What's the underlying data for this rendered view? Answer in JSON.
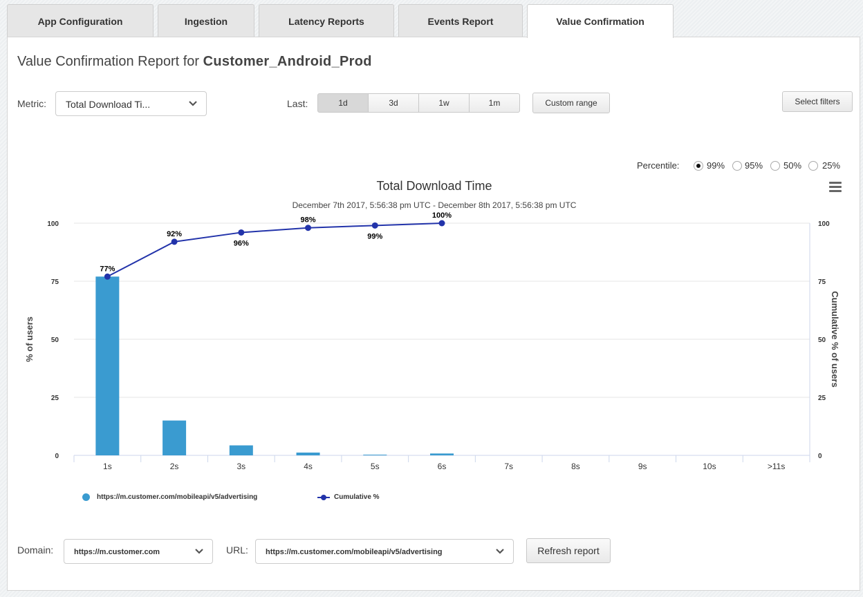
{
  "tabs": [
    {
      "label": "App Configuration",
      "active": false
    },
    {
      "label": "Ingestion",
      "active": false
    },
    {
      "label": "Latency Reports",
      "active": false
    },
    {
      "label": "Events Report",
      "active": false
    },
    {
      "label": "Value Confirmation",
      "active": true
    }
  ],
  "report": {
    "title_prefix": "Value Confirmation Report for",
    "app_name": "Customer_Android_Prod"
  },
  "controls": {
    "metric_label": "Metric:",
    "metric_value": "Total Download Ti...",
    "last_label": "Last:",
    "ranges": [
      {
        "label": "1d",
        "active": true
      },
      {
        "label": "3d",
        "active": false
      },
      {
        "label": "1w",
        "active": false
      },
      {
        "label": "1m",
        "active": false
      }
    ],
    "custom_range": "Custom range",
    "select_filters": "Select filters"
  },
  "percentile": {
    "label": "Percentile:",
    "options": [
      {
        "label": "99%",
        "selected": true
      },
      {
        "label": "95%",
        "selected": false
      },
      {
        "label": "50%",
        "selected": false
      },
      {
        "label": "25%",
        "selected": false
      }
    ]
  },
  "chart_data": {
    "type": "bar",
    "title": "Total Download Time",
    "subtitle": "December 7th 2017, 5:56:38 pm UTC - December 8th 2017, 5:56:38 pm UTC",
    "categories": [
      "1s",
      "2s",
      "3s",
      "4s",
      "5s",
      "6s",
      "7s",
      "8s",
      "9s",
      "10s",
      ">11s"
    ],
    "series": [
      {
        "name": "https://m.customer.com/mobileapi/v5/advertising",
        "kind": "bar",
        "color": "#3a9bd0",
        "values": [
          77,
          15,
          4.3,
          1.2,
          0.3,
          0.8,
          0,
          0,
          0,
          0,
          0
        ]
      },
      {
        "name": "Cumulative %",
        "kind": "line",
        "color": "#2233aa",
        "values": [
          77,
          92,
          96,
          98,
          99,
          100
        ],
        "labels": [
          "77%",
          "92%",
          "96%",
          "98%",
          "99%",
          "100%"
        ]
      }
    ],
    "ylabel": "% of users",
    "y2label": "Cumulative % of users",
    "ylim": [
      0,
      100
    ],
    "y2lim": [
      0,
      100
    ],
    "yticks": [
      0,
      25,
      50,
      75,
      100
    ],
    "grid": true,
    "legend_position": "bottom-left"
  },
  "footer": {
    "domain_label": "Domain:",
    "domain_value": "https://m.customer.com",
    "url_label": "URL:",
    "url_value": "https://m.customer.com/mobileapi/v5/advertising",
    "refresh": "Refresh report"
  }
}
